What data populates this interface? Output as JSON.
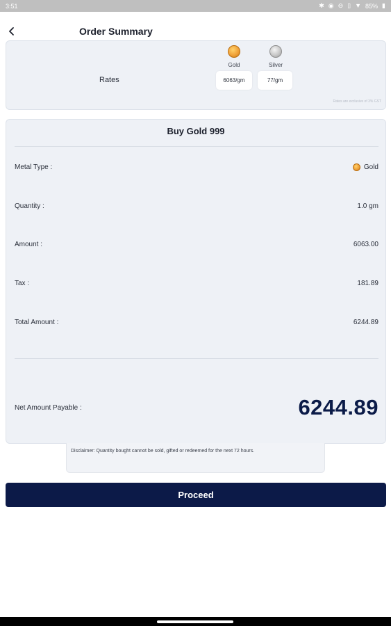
{
  "status_bar": {
    "time": "3:51",
    "battery": "85%",
    "icons": [
      "bluetooth-icon",
      "eye-icon",
      "dnd-icon",
      "vibrate-icon",
      "wifi-icon",
      "battery-icon"
    ]
  },
  "header": {
    "title": "Order Summary",
    "back_icon": "back-arrow-icon"
  },
  "rates": {
    "label": "Rates",
    "gold": {
      "name": "Gold",
      "rate": "6063/gm",
      "icon": "gold-coin-icon"
    },
    "silver": {
      "name": "Silver",
      "rate": "77/gm",
      "icon": "silver-coin-icon"
    },
    "note": "Rates are exclusive of 3% GST"
  },
  "summary": {
    "title": "Buy Gold 999",
    "rows": [
      {
        "label": "Metal Type :",
        "value": "Gold"
      },
      {
        "label": "Quantity :",
        "value": "1.0 gm"
      },
      {
        "label": "Amount :",
        "value": "6063.00"
      },
      {
        "label": "Tax :",
        "value": "181.89"
      },
      {
        "label": "Total Amount :",
        "value": "6244.89"
      }
    ],
    "net": {
      "label": "Net Amount Payable :",
      "value": "6244.89"
    }
  },
  "disclaimer": "Disclaimer: Quantity bought cannot be sold, gifted or redeemed for the next 72 hours.",
  "actions": {
    "proceed_label": "Proceed"
  },
  "colors": {
    "primary": "#0c1a48",
    "card_bg": "#eef1f6",
    "gold": "#f0a23a",
    "silver": "#c8c8c8"
  }
}
